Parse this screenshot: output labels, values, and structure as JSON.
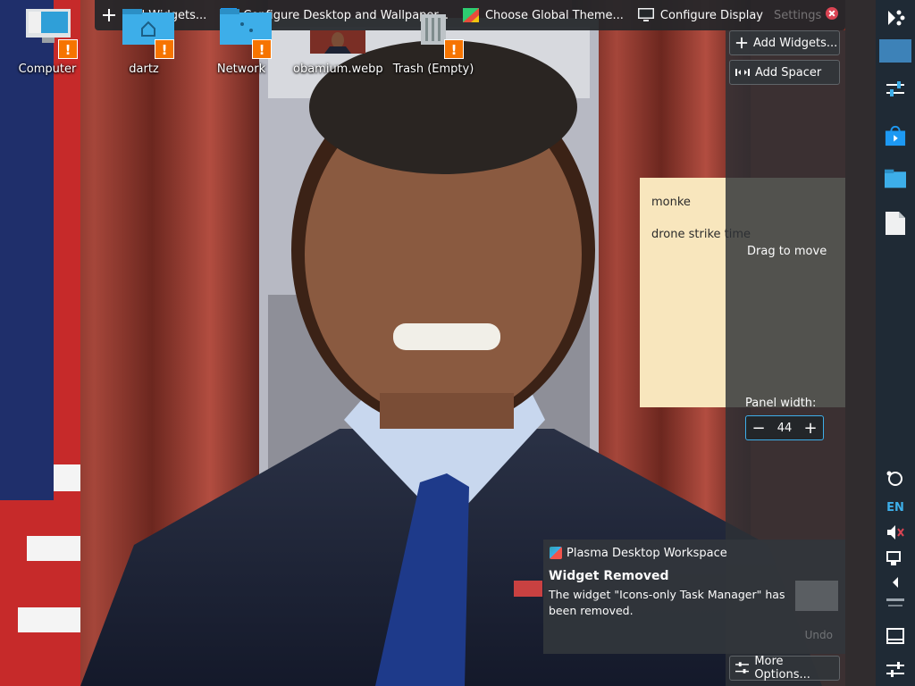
{
  "toolbar": {
    "items": [
      {
        "label": "Add Widgets...",
        "icon": "plus-icon"
      },
      {
        "label": "Configure Desktop and Wallpaper...",
        "icon": "desktop-wallpaper-icon"
      },
      {
        "label": "Choose Global Theme...",
        "icon": "theme-icon"
      },
      {
        "label": "Configure Display",
        "icon": "display-icon"
      }
    ],
    "truncated_label": "Settings"
  },
  "desktop_icons": [
    {
      "label": "Computer",
      "icon": "computer-icon",
      "warning": "!"
    },
    {
      "label": "dartz",
      "icon": "home-folder-icon",
      "warning": "!"
    },
    {
      "label": "Network",
      "icon": "network-folder-icon",
      "warning": "!"
    },
    {
      "label": "obamium.webp",
      "icon": "image-thumbnail-icon"
    },
    {
      "label": "Trash (Empty)",
      "icon": "trash-icon",
      "warning": "!"
    }
  ],
  "sticky_note": {
    "lines": [
      "monke",
      "drone strike time"
    ]
  },
  "panel_config": {
    "add_widgets": "Add Widgets...",
    "add_spacer": "Add Spacer",
    "drag_to_move": "Drag to move",
    "panel_width_label": "Panel width:",
    "panel_width_value": "44",
    "more_options": "More Options..."
  },
  "right_panel": {
    "language": "EN"
  },
  "notification": {
    "app_name": "Plasma Desktop Workspace",
    "title": "Widget Removed",
    "body": "The widget \"Icons-only Task Manager\" has been removed.",
    "undo_label": "Undo"
  },
  "colors": {
    "accent": "#3daee9",
    "panel_bg": "#1f2a35",
    "warning": "#f67400",
    "note": "#f8e6bd"
  }
}
